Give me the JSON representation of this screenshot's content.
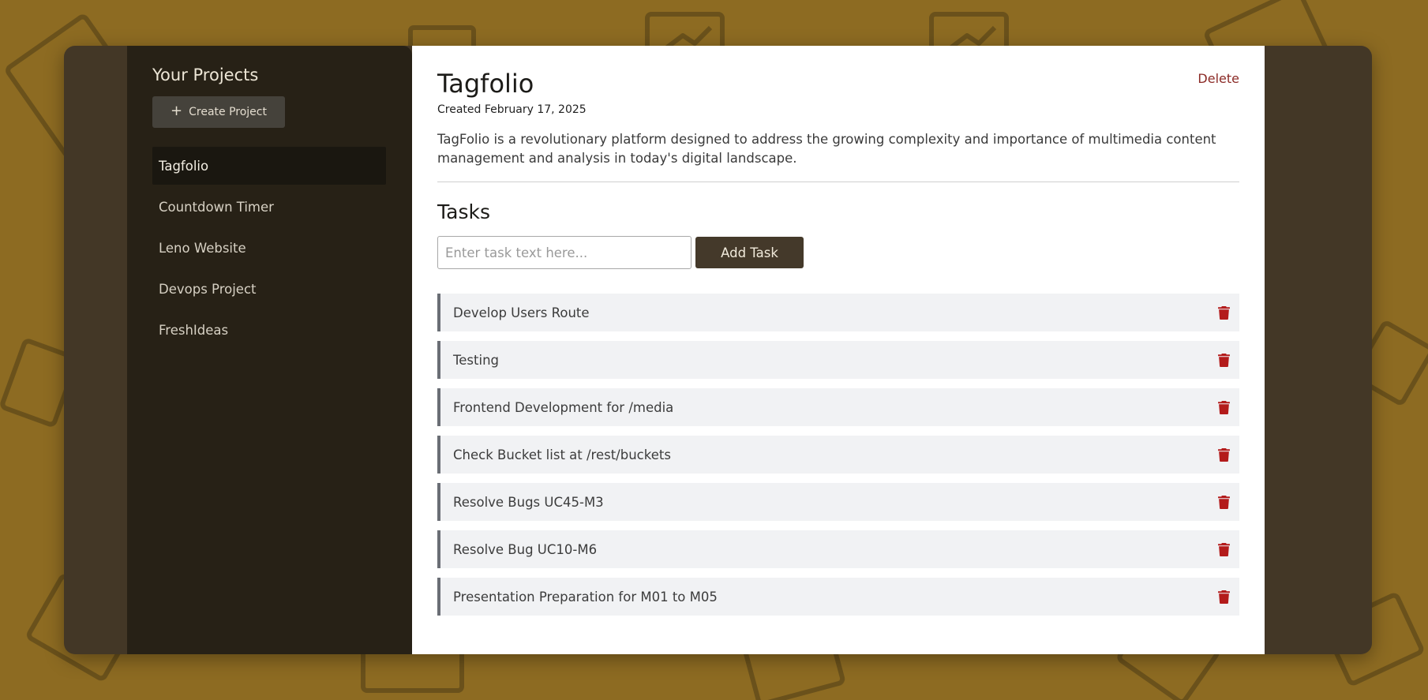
{
  "sidebar": {
    "title": "Your Projects",
    "create_button": {
      "icon": "plus-icon",
      "label": "Create Project"
    },
    "projects": [
      {
        "label": "Tagfolio",
        "active": true
      },
      {
        "label": "Countdown Timer",
        "active": false
      },
      {
        "label": "Leno Website",
        "active": false
      },
      {
        "label": "Devops Project",
        "active": false
      },
      {
        "label": "FreshIdeas",
        "active": false
      }
    ]
  },
  "project": {
    "title": "Tagfolio",
    "created": "Created February 17, 2025",
    "delete_label": "Delete",
    "description": "TagFolio is a revolutionary platform designed to address the growing complexity and importance of multimedia content management and analysis in today's digital landscape."
  },
  "tasks": {
    "title": "Tasks",
    "input_placeholder": "Enter task text here...",
    "add_label": "Add Task",
    "items": [
      "Develop Users Route",
      "Testing",
      "Frontend Development for /media",
      "Check Bucket list at /rest/buckets",
      "Resolve Bugs UC45-M3",
      "Resolve Bug UC10-M6",
      "Presentation Preparation for M01 to M05"
    ]
  },
  "colors": {
    "background": "#8d6b22",
    "sidebar": "#272116",
    "accent": "#44392a",
    "delete": "#8b2a26",
    "trash": "#b31b1b"
  }
}
